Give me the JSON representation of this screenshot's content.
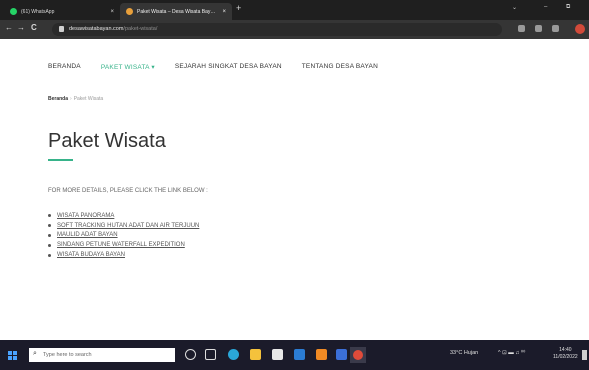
{
  "browser": {
    "tabs": [
      {
        "label": "(61) WhatsApp",
        "close": "×",
        "favicon_color": "#25d366"
      },
      {
        "label": "Paket Wisata – Desa Wisata Bay…",
        "close": "×",
        "favicon_color": "#e9a03b"
      }
    ],
    "new_tab": "+",
    "window_controls": {
      "minimize": "–",
      "restore": "⧉",
      "chevrons": "⌄"
    },
    "nav": {
      "back": "←",
      "forward": "→",
      "reload": "C"
    },
    "address": {
      "host": "desawisatabayan.com",
      "path": "/paket-wisata/"
    }
  },
  "site": {
    "nav": [
      {
        "label": "BERANDA"
      },
      {
        "label": "PAKET WISATA ▾",
        "active": true
      },
      {
        "label": "SEJARAH SINGKAT DESA BAYAN"
      },
      {
        "label": "TENTANG DESA BAYAN"
      }
    ],
    "breadcrumb": {
      "home": "Beranda",
      "sep": "›",
      "current": "Paket Wisata"
    },
    "title": "Paket Wisata",
    "intro": "FOR MORE DETAILS, PLEASE CLICK THE LINK BELOW :",
    "links": [
      "WISATA PANORAMA",
      "SOFT TRACKING HUTAN ADAT DAN AIR  TERJUUN",
      "MAULID ADAT BAYAN",
      "SINDANG PETUNE WATERFALL EXPEDITION",
      "WISATA BUDAYA BAYAN"
    ]
  },
  "taskbar": {
    "search_placeholder": "Type here to search",
    "weather": "33°C  Hujan",
    "tray_icons": "^  ⊡  ▬  ♫  ⁰⁰",
    "time": "14:40",
    "date": "11/02/2022"
  },
  "colors": {
    "accent": "#37b38a",
    "taskbar": "#1b1b2a",
    "chrome_dark": "#1f1f1f"
  }
}
